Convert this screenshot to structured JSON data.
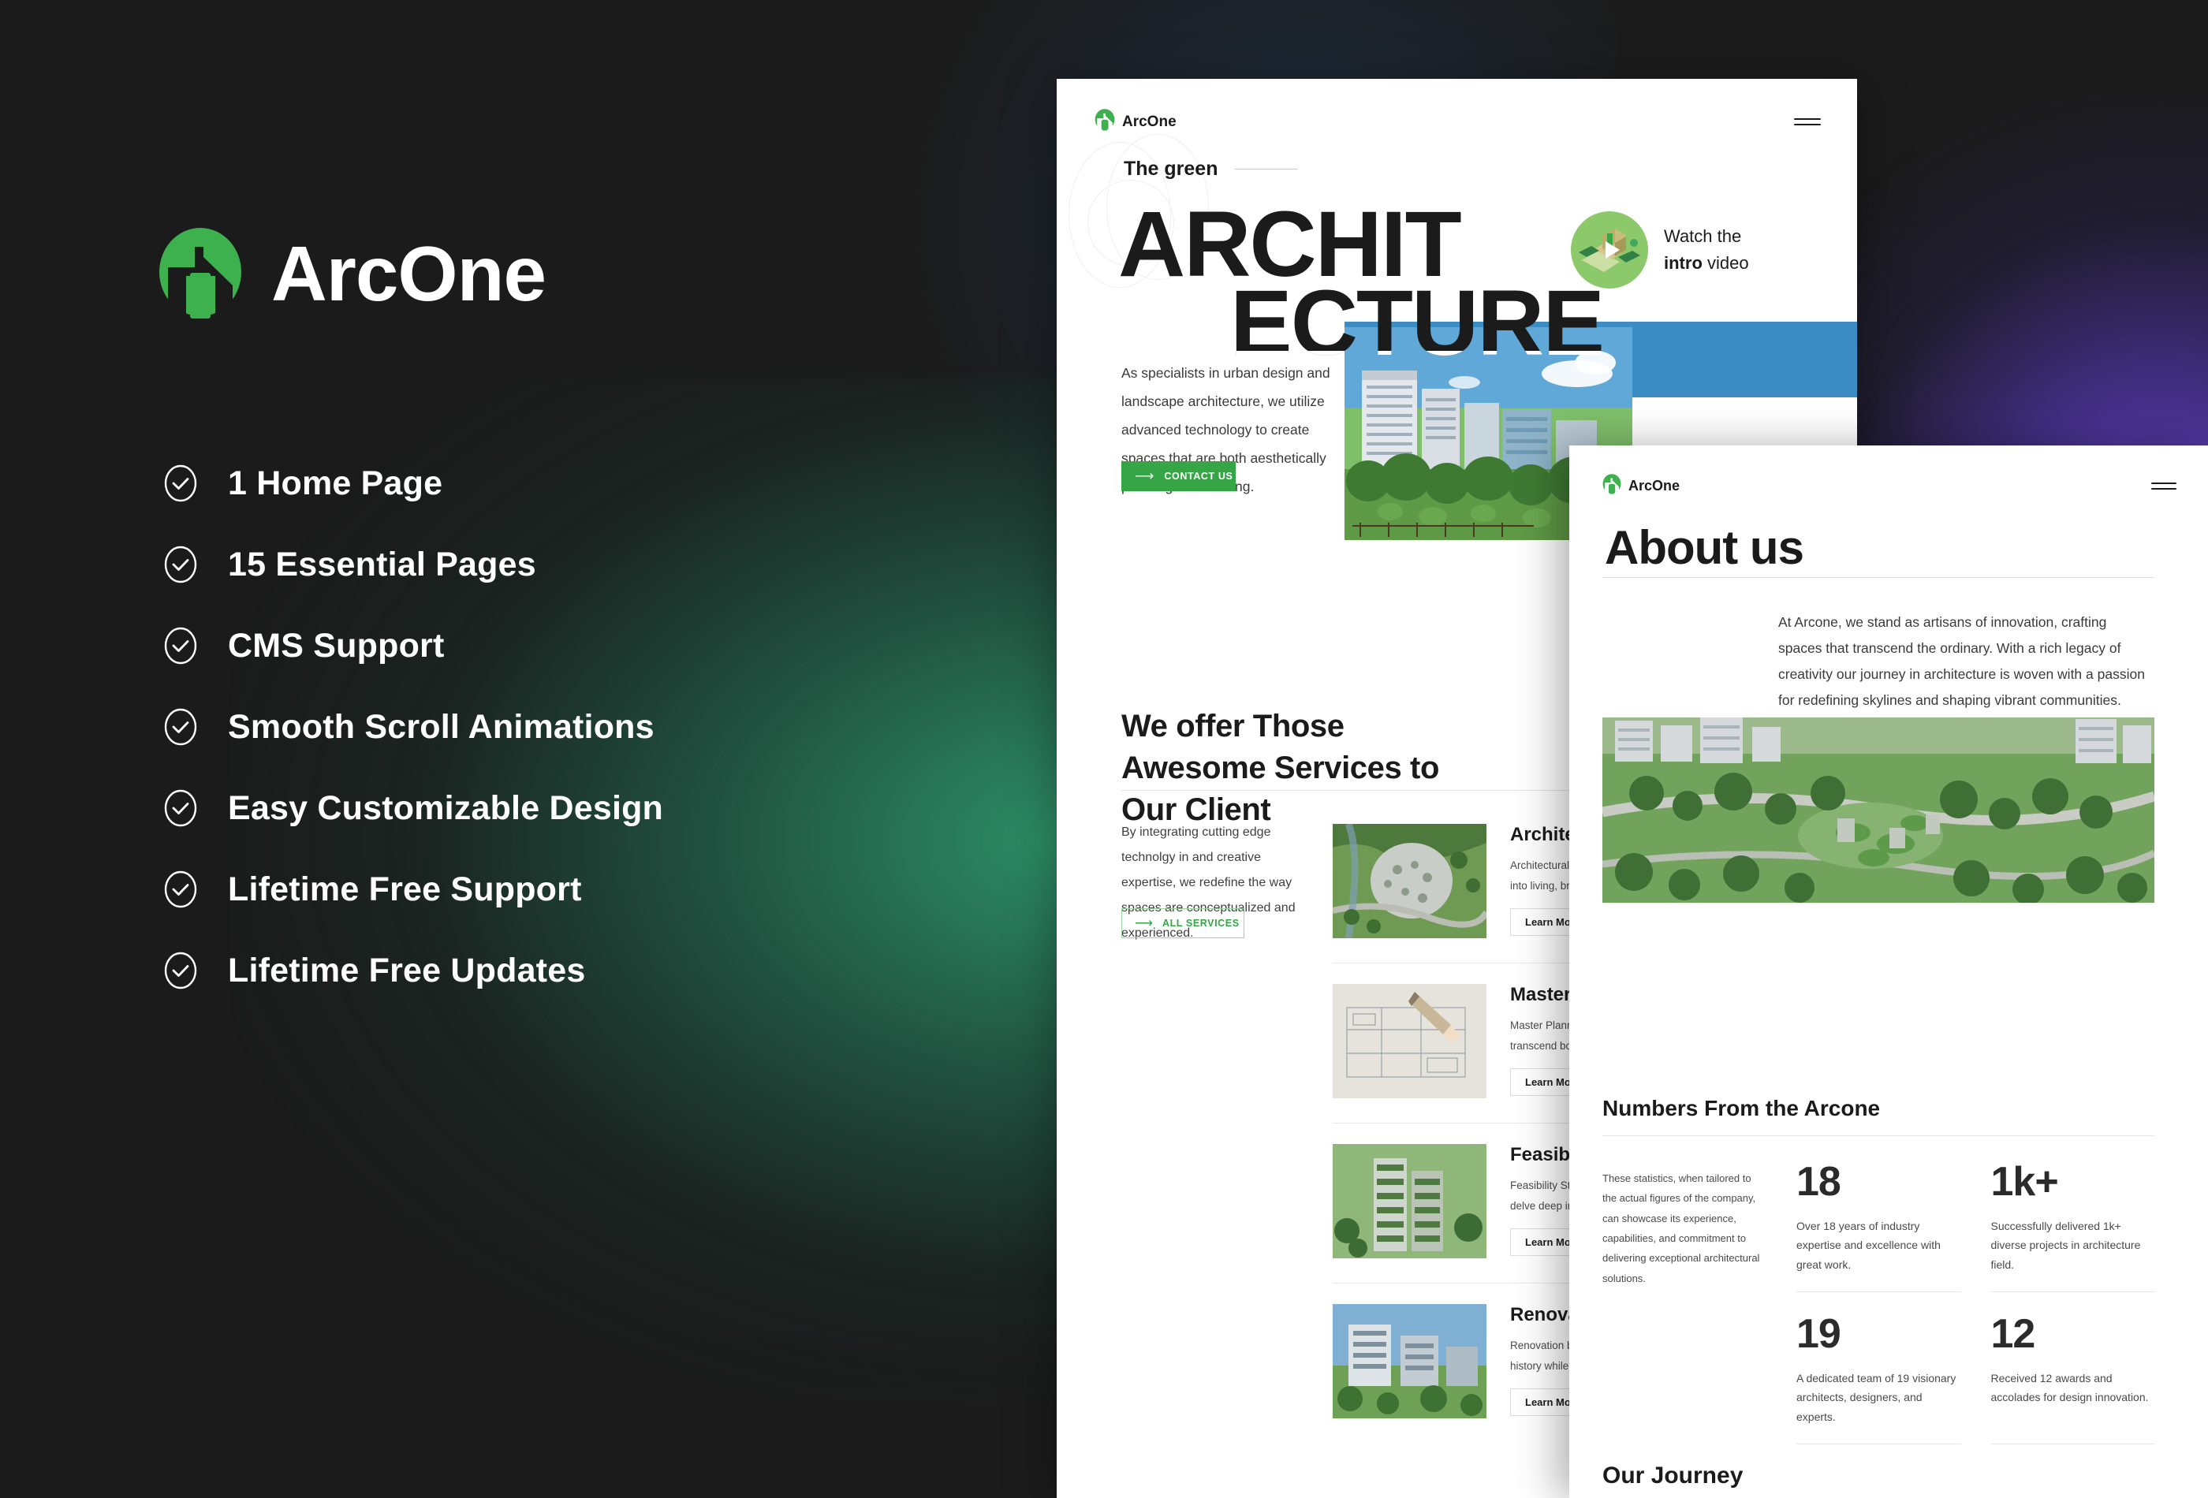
{
  "brand": {
    "name": "ArcOne",
    "logo_icon": "arcone-house-logo",
    "accent_green": "#35a545",
    "accent_purple": "#6b46d7"
  },
  "features": [
    {
      "label": "1 Home Page",
      "icon": "check-circle-icon"
    },
    {
      "label": "15 Essential Pages",
      "icon": "check-circle-icon"
    },
    {
      "label": "CMS Support",
      "icon": "check-circle-icon"
    },
    {
      "label": "Smooth Scroll Animations",
      "icon": "check-circle-icon"
    },
    {
      "label": "Easy Customizable Design",
      "icon": "check-circle-icon"
    },
    {
      "label": "Lifetime Free Support",
      "icon": "check-circle-icon"
    },
    {
      "label": "Lifetime Free Updates",
      "icon": "check-circle-icon"
    }
  ],
  "mock_home": {
    "header": {
      "logo_text": "ArcOne",
      "menu_icon": "hamburger-menu-icon"
    },
    "hero": {
      "eyebrow": "The green",
      "title_line1": "ARCHIT",
      "title_line2": "ECTURE",
      "paragraph": "As specialists in urban design and landscape architecture, we utilize advanced technology to create spaces that are both aesthetically pleasing and exciting.",
      "cta_label": "CONTACT US",
      "cta_icon": "arrow-right-icon",
      "watch_line1": "Watch the",
      "watch_bold": "intro",
      "watch_rest": " video",
      "watch_icon": "play-icon"
    },
    "services": {
      "title": "We offer Those Awesome Services to Our Client",
      "paragraph": "By integrating cutting edge technolgy in and creative expertise, we redefine the way spaces are conceptualized and experienced.",
      "all_label": "ALL SERVICES",
      "all_icon": "arrow-right-icon",
      "items": [
        {
          "name": "Architecture",
          "desc": "Architectural design blends form and function to transform abstract ideas into living, breathing spaces.",
          "more": "Learn More"
        },
        {
          "name": "Master Planning",
          "desc": "Master Planning crafts visionary landscapes and urban spaces that transcend boundaries of form, function, and community.",
          "more": "Learn More"
        },
        {
          "name": "Feasibility Studies",
          "desc": "Feasibility Studies are the compass meticulously charting the course. We delve deep into data and analysis to outline the possibilities.",
          "more": "Learn More"
        },
        {
          "name": "Renovation",
          "desc": "Renovation breathes new life into existing structures, honoring their history while reimagining their future.",
          "more": "Learn More"
        }
      ]
    }
  },
  "mock_about": {
    "header": {
      "logo_text": "ArcOne",
      "menu_icon": "hamburger-menu-icon"
    },
    "title": "About us",
    "paragraph": "At Arcone, we stand as artisans of innovation, crafting spaces that transcend the ordinary. With a rich legacy of creativity our journey in architecture is woven with a passion for redefining skylines and shaping vibrant communities.",
    "numbers": {
      "title": "Numbers From the Arcone",
      "paragraph": "These statistics, when tailored to the actual figures of the company, can showcase its experience, capabilities, and commitment to delivering exceptional architectural solutions.",
      "stats": [
        {
          "value": "18",
          "desc": "Over 18 years of industry expertise and excellence with great work."
        },
        {
          "value": "1k+",
          "desc": "Successfully delivered 1k+ diverse projects in architecture field."
        },
        {
          "value": "19",
          "desc": "A dedicated team of 19 visionary architects, designers, and experts."
        },
        {
          "value": "12",
          "desc": "Received 12 awards and accolades for design innovation."
        }
      ]
    },
    "journey_title": "Our Journey"
  }
}
